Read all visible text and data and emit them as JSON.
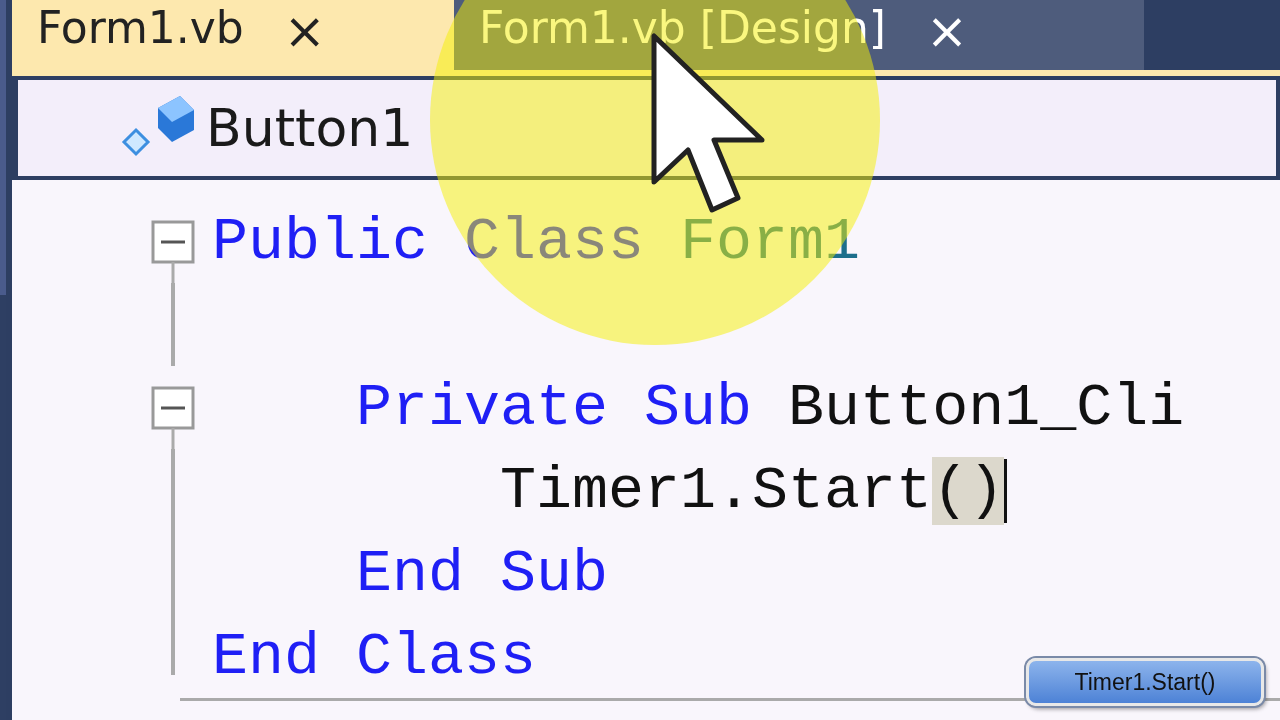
{
  "tabs": [
    {
      "label": "Form1.vb",
      "selected": true,
      "close": "×"
    },
    {
      "label": "Form1.vb [Design]",
      "selected": false,
      "close": "×"
    }
  ],
  "navigation_bar": {
    "member": "Button1"
  },
  "editor": {
    "lines": [
      {
        "kind": "collapse",
        "tokens": [
          {
            "kind": "keyword",
            "text": "Public "
          },
          {
            "kind": "keyword",
            "text": "Class "
          },
          {
            "kind": "type",
            "text": "Form1"
          }
        ]
      },
      {
        "kind": "line"
      },
      {
        "kind": "collapse",
        "tokens": [
          {
            "kind": "keyword",
            "text": "    Private "
          },
          {
            "kind": "keyword",
            "text": "Sub "
          },
          {
            "kind": "plain",
            "text": "Button1_Cli"
          }
        ]
      },
      {
        "kind": "line",
        "caret": true,
        "tokens": [
          {
            "kind": "plain",
            "text": "        Timer1.Start"
          },
          {
            "kind": "brace_match",
            "text": "()"
          }
        ]
      },
      {
        "kind": "line",
        "tokens": [
          {
            "kind": "keyword",
            "text": "    End "
          },
          {
            "kind": "keyword",
            "text": "Sub"
          }
        ]
      },
      {
        "kind": "end",
        "tokens": [
          {
            "kind": "keyword",
            "text": "End "
          },
          {
            "kind": "keyword",
            "text": "Class"
          }
        ]
      }
    ]
  },
  "caption": "Timer1.Start()"
}
